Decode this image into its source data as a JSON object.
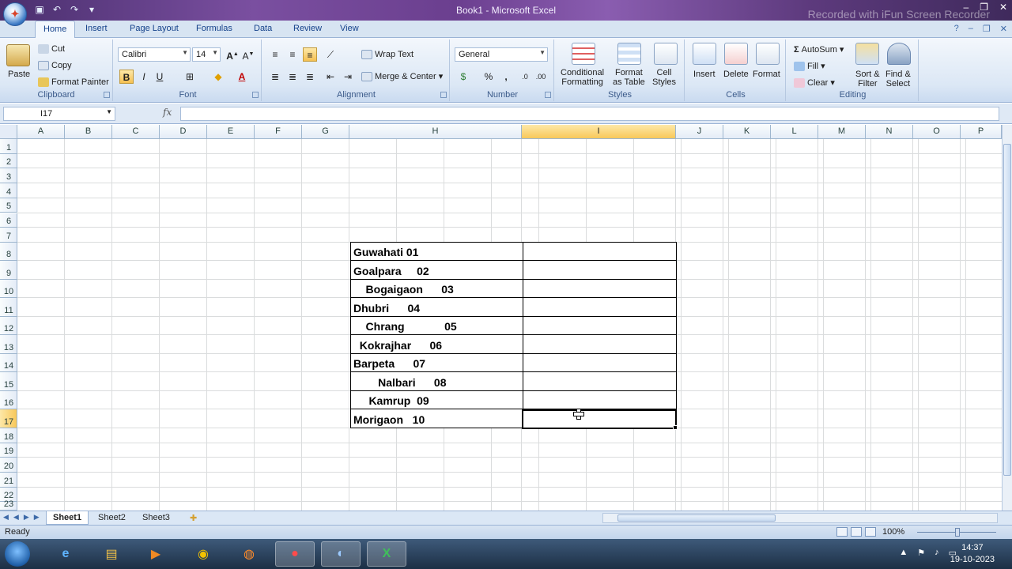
{
  "window": {
    "title": "Book1 - Microsoft Excel",
    "watermark": "Recorded with iFun Screen Recorder"
  },
  "ribbon_tabs": [
    "Home",
    "Insert",
    "Page Layout",
    "Formulas",
    "Data",
    "Review",
    "View"
  ],
  "ribbon": {
    "clipboard": {
      "label": "Clipboard",
      "paste": "Paste",
      "cut": "Cut",
      "copy": "Copy",
      "format_painter": "Format Painter"
    },
    "font": {
      "label": "Font",
      "font_name": "Calibri",
      "font_size": "14",
      "bold": "B",
      "italic": "I",
      "underline": "U"
    },
    "alignment": {
      "label": "Alignment",
      "wrap_text": "Wrap Text",
      "merge_center": "Merge & Center"
    },
    "number": {
      "label": "Number",
      "format": "General",
      "percent": "%",
      "comma": ","
    },
    "styles": {
      "label": "Styles",
      "conditional": "Conditional",
      "conditional2": "Formatting",
      "format_table": "Format",
      "format_table2": "as Table",
      "cell_styles": "Cell",
      "cell_styles2": "Styles"
    },
    "cells": {
      "label": "Cells",
      "insert": "Insert",
      "delete": "Delete",
      "format": "Format"
    },
    "editing": {
      "label": "Editing",
      "autosum": "AutoSum",
      "fill": "Fill",
      "clear": "Clear",
      "sort_filter": "Sort &",
      "sort_filter2": "Filter",
      "find_select": "Find &",
      "find_select2": "Select"
    }
  },
  "formula_bar": {
    "name_box": "I17",
    "fx": "fx",
    "content": ""
  },
  "columns": [
    "A",
    "B",
    "C",
    "D",
    "E",
    "F",
    "G",
    "H",
    "I",
    "J",
    "K",
    "L",
    "M",
    "N",
    "O",
    "P"
  ],
  "rows": [
    "1",
    "2",
    "3",
    "4",
    "5",
    "6",
    "7",
    "8",
    "9",
    "10",
    "11",
    "12",
    "13",
    "14",
    "15",
    "16",
    "17",
    "18",
    "19",
    "20",
    "21",
    "22",
    "23"
  ],
  "selected": {
    "column": "I",
    "row": "17"
  },
  "cells_h": [
    "Guwahati 01",
    "Goalpara     02",
    "    Bogaigaon      03",
    "Dhubri      04",
    "    Chrang             05",
    "  Kokrajhar      06",
    "Barpeta      07",
    "        Nalbari      08",
    "     Kamrup  09",
    "Morigaon   10"
  ],
  "sheet_tabs": [
    "Sheet1",
    "Sheet2",
    "Sheet3"
  ],
  "status": {
    "ready": "Ready",
    "zoom": "100%"
  },
  "taskbar": {
    "time": "14:37",
    "date": "19-10-2023"
  }
}
